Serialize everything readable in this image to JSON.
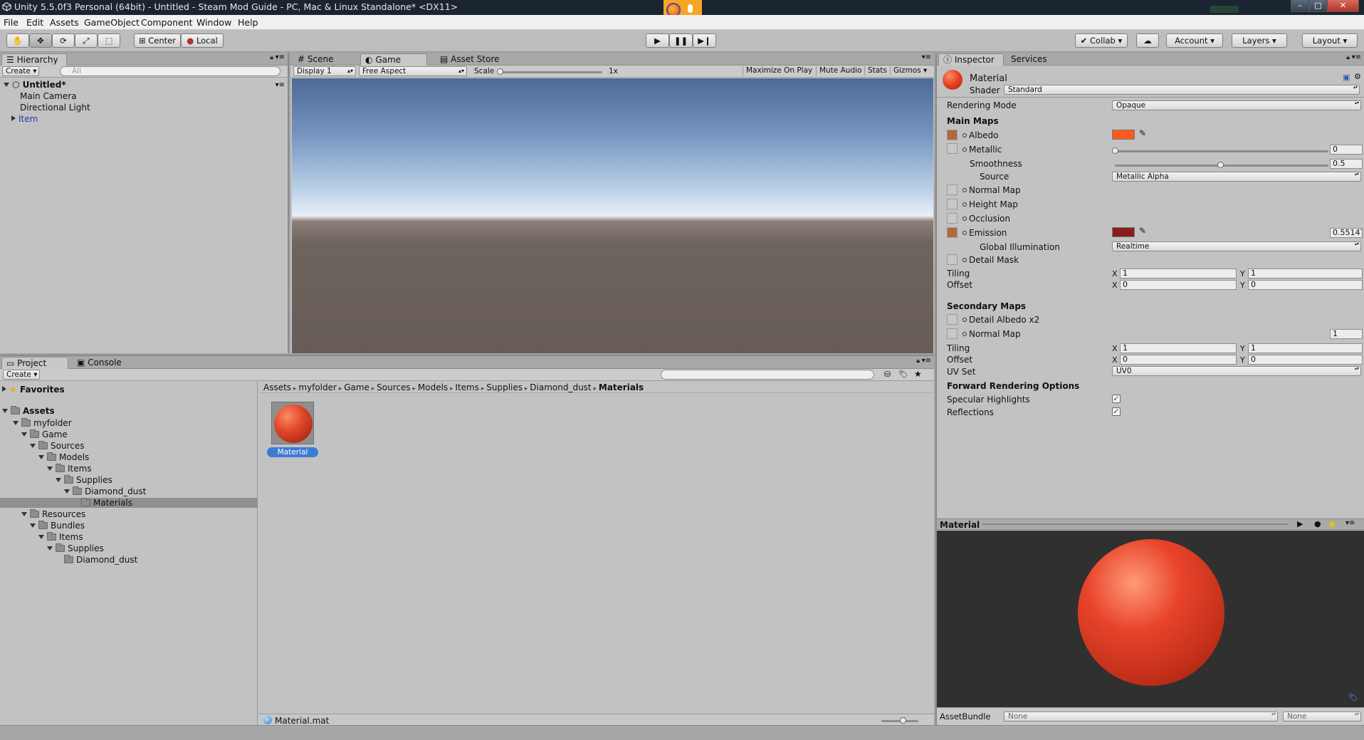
{
  "window": {
    "title": "Unity 5.5.0f3 Personal (64bit) - Untitled - Steam Mod Guide - PC, Mac & Linux Standalone* <DX11>",
    "controls": [
      "–",
      "□",
      "✕"
    ]
  },
  "menu": [
    "File",
    "Edit",
    "Assets",
    "GameObject",
    "Component",
    "Window",
    "Help"
  ],
  "toolbar": {
    "pivot": "Center",
    "space": "Local",
    "collab": "Collab",
    "account": "Account",
    "layers": "Layers",
    "layout": "Layout"
  },
  "hierarchy": {
    "tab": "Hierarchy",
    "create": "Create",
    "search_placeholder": "All",
    "scene": "Untitled*",
    "items": [
      "Main Camera",
      "Directional Light",
      "Item"
    ]
  },
  "viewtabs": {
    "scene": "Scene",
    "game": "Game",
    "asset_store": "Asset Store"
  },
  "game": {
    "display": "Display 1",
    "aspect": "Free Aspect",
    "scale_label": "Scale",
    "scale_value": "1x",
    "maximize": "Maximize On Play",
    "mute": "Mute Audio",
    "stats": "Stats",
    "gizmos": "Gizmos"
  },
  "project": {
    "tab_project": "Project",
    "tab_console": "Console",
    "create": "Create",
    "favorites": "Favorites",
    "assets": "Assets",
    "tree": [
      {
        "label": "myfolder",
        "depth": 1
      },
      {
        "label": "Game",
        "depth": 2
      },
      {
        "label": "Sources",
        "depth": 3
      },
      {
        "label": "Models",
        "depth": 4
      },
      {
        "label": "Items",
        "depth": 5
      },
      {
        "label": "Supplies",
        "depth": 6
      },
      {
        "label": "Diamond_dust",
        "depth": 7
      },
      {
        "label": "Materials",
        "depth": 8
      },
      {
        "label": "Resources",
        "depth": 2
      },
      {
        "label": "Bundles",
        "depth": 3
      },
      {
        "label": "Items",
        "depth": 4
      },
      {
        "label": "Supplies",
        "depth": 5
      },
      {
        "label": "Diamond_dust",
        "depth": 6
      }
    ],
    "breadcrumb": [
      "Assets",
      "myfolder",
      "Game",
      "Sources",
      "Models",
      "Items",
      "Supplies",
      "Diamond_dust",
      "Materials"
    ],
    "asset_label": "Material",
    "status_file": "Material.mat"
  },
  "inspector": {
    "tab_inspector": "Inspector",
    "tab_services": "Services",
    "material_name": "Material",
    "shader_label": "Shader",
    "shader_value": "Standard",
    "rendering_mode_label": "Rendering Mode",
    "rendering_mode_value": "Opaque",
    "main_maps": "Main Maps",
    "albedo": "Albedo",
    "metallic": "Metallic",
    "metallic_value": "0",
    "smoothness": "Smoothness",
    "smoothness_value": "0.5",
    "source": "Source",
    "source_value": "Metallic Alpha",
    "normal_map": "Normal Map",
    "height_map": "Height Map",
    "occlusion": "Occlusion",
    "emission": "Emission",
    "emission_value": "0.55147",
    "global_illumination": "Global Illumination",
    "gi_value": "Realtime",
    "detail_mask": "Detail Mask",
    "tiling": "Tiling",
    "offset": "Offset",
    "tiling_x": "1",
    "tiling_y": "1",
    "offset_x": "0",
    "offset_y": "0",
    "secondary_maps": "Secondary Maps",
    "detail_albedo": "Detail Albedo x2",
    "normal_map2": "Normal Map",
    "normal_map2_value": "1",
    "tiling2_x": "1",
    "tiling2_y": "1",
    "offset2_x": "0",
    "offset2_y": "0",
    "uv_set": "UV Set",
    "uv_set_value": "UV0",
    "forward_options": "Forward Rendering Options",
    "specular_highlights": "Specular Highlights",
    "reflections": "Reflections",
    "x": "X",
    "y": "Y",
    "preview_title": "Material",
    "assetbundle_label": "AssetBundle",
    "assetbundle_value": "None",
    "assetbundle_variant": "None"
  },
  "colors": {
    "albedo": "#ff5a1e",
    "emission": "#8a1c1c",
    "sphere": "#e8432a",
    "titlebar": "#1b2532"
  }
}
